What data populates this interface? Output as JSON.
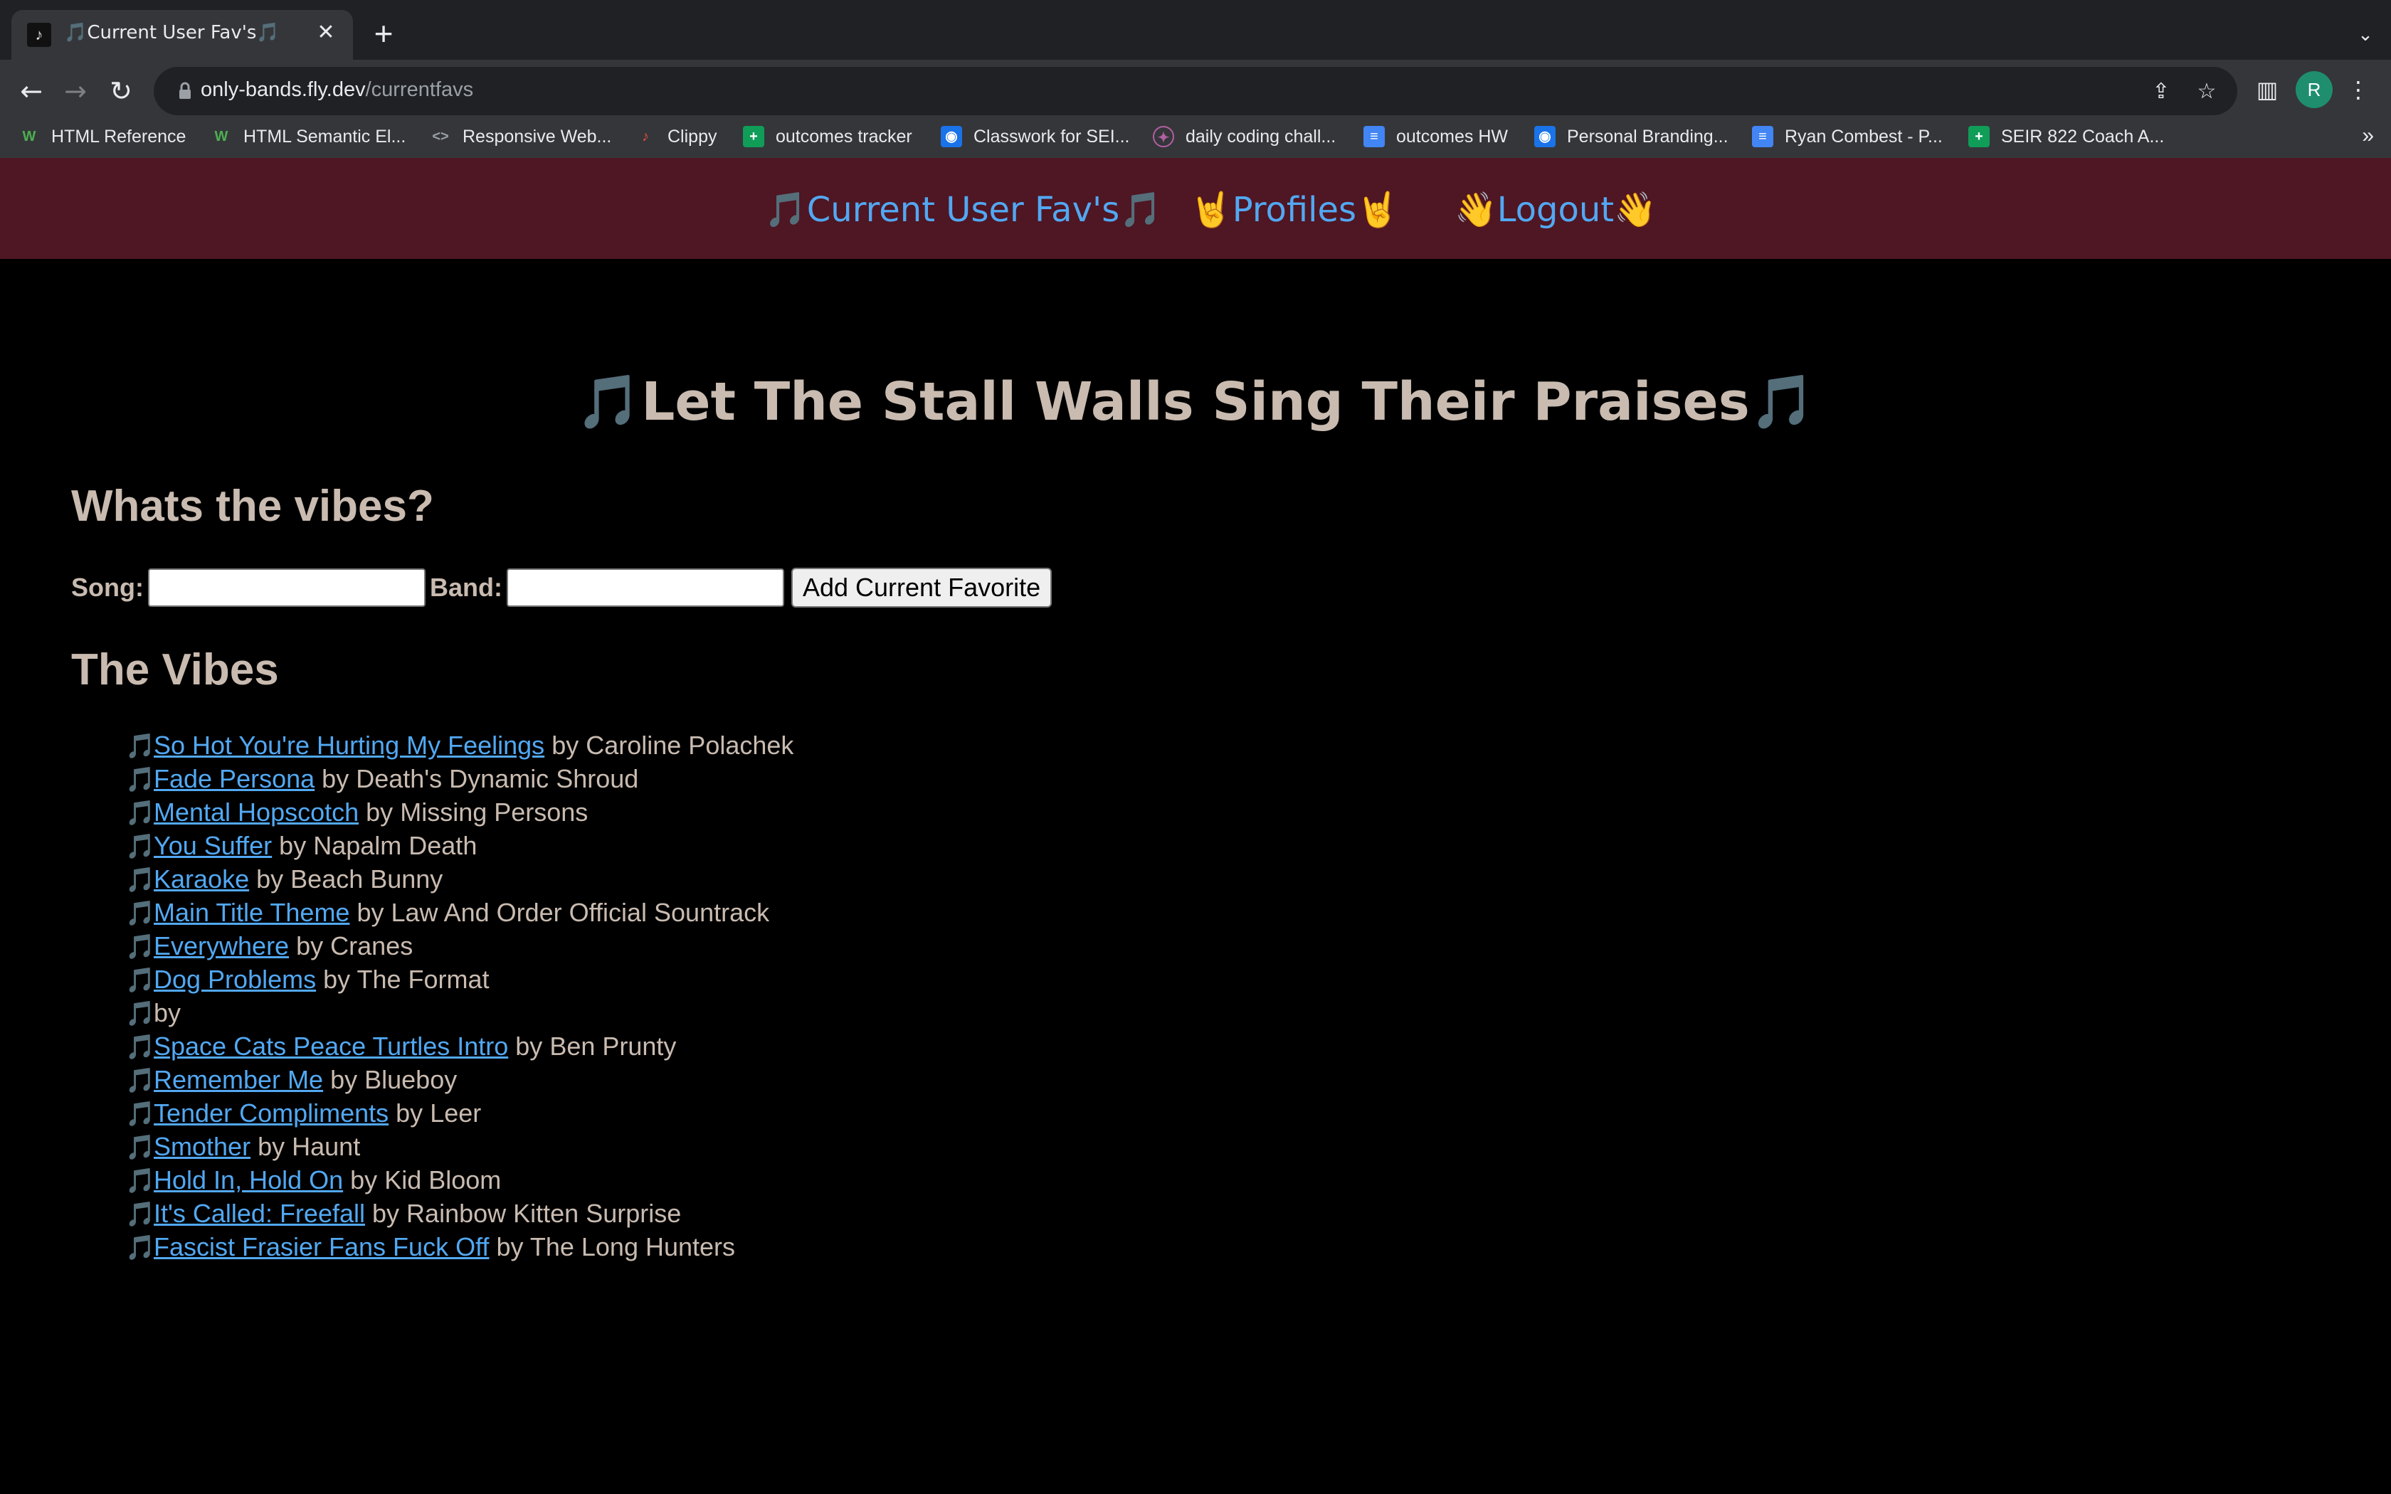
{
  "browser": {
    "tab_title": "🎵Current User Fav's🎵",
    "url_host": "only-bands.fly.dev",
    "url_path": "/currentfavs",
    "avatar_letter": "R",
    "icons": {
      "back": "back-arrow-icon",
      "forward": "forward-arrow-icon",
      "reload": "reload-icon",
      "lock": "lock-icon",
      "share": "share-icon",
      "bookmark": "star-icon",
      "sidepanel": "side-panel-icon",
      "menu": "kebab-menu-icon"
    },
    "bookmarks": [
      {
        "label": "HTML Reference",
        "icon": "w3-icon"
      },
      {
        "label": "HTML Semantic El...",
        "icon": "w3-icon"
      },
      {
        "label": "Responsive Web...",
        "icon": "code-icon"
      },
      {
        "label": "Clippy",
        "icon": "clippy-icon"
      },
      {
        "label": "outcomes tracker",
        "icon": "sheets-icon"
      },
      {
        "label": "Classwork for SEI...",
        "icon": "classroom-icon"
      },
      {
        "label": "daily coding chall...",
        "icon": "challenge-icon"
      },
      {
        "label": "outcomes HW",
        "icon": "docs-icon"
      },
      {
        "label": "Personal Branding...",
        "icon": "classroom-icon"
      },
      {
        "label": "Ryan Combest - P...",
        "icon": "docs-icon"
      },
      {
        "label": "SEIR 822 Coach A...",
        "icon": "sheets-icon"
      }
    ],
    "bookmarks_more": "»"
  },
  "nav": {
    "current_favs": "🎵Current User Fav's🎵",
    "profiles": "🤘Profiles🤘",
    "logout": "👋Logout👋"
  },
  "page": {
    "title": "🎵Let The Stall Walls Sing Their Praises🎵",
    "form_heading": "Whats the vibes?",
    "song_label": "Song:",
    "band_label": "Band:",
    "submit_label": "Add Current Favorite",
    "list_heading": "The Vibes",
    "note_glyph": "🎵",
    "by_word": "by"
  },
  "favorites": [
    {
      "song": "So Hot You're Hurting My Feelings",
      "band": "Caroline Polachek"
    },
    {
      "song": "Fade Persona",
      "band": "Death's Dynamic Shroud"
    },
    {
      "song": "Mental Hopscotch",
      "band": "Missing Persons"
    },
    {
      "song": "You Suffer",
      "band": "Napalm Death"
    },
    {
      "song": "Karaoke",
      "band": "Beach Bunny"
    },
    {
      "song": "Main Title Theme",
      "band": "Law And Order Official Sountrack"
    },
    {
      "song": "Everywhere",
      "band": "Cranes"
    },
    {
      "song": "Dog Problems",
      "band": "The Format"
    },
    {
      "song": "",
      "band": ""
    },
    {
      "song": "Space Cats Peace Turtles Intro",
      "band": "Ben Prunty"
    },
    {
      "song": "Remember Me",
      "band": "Blueboy"
    },
    {
      "song": "Tender Compliments",
      "band": "Leer"
    },
    {
      "song": "Smother",
      "band": "Haunt"
    },
    {
      "song": "Hold In, Hold On",
      "band": "Kid Bloom"
    },
    {
      "song": "It's Called: Freefall",
      "band": "Rainbow Kitten Surprise"
    },
    {
      "song": "Fascist Frasier Fans Fuck Off",
      "band": "The Long Hunters"
    }
  ],
  "colors": {
    "nav_bg": "#4f1623",
    "link": "#52a8f2",
    "text": "#c9bbb0",
    "page_bg": "#000000"
  }
}
